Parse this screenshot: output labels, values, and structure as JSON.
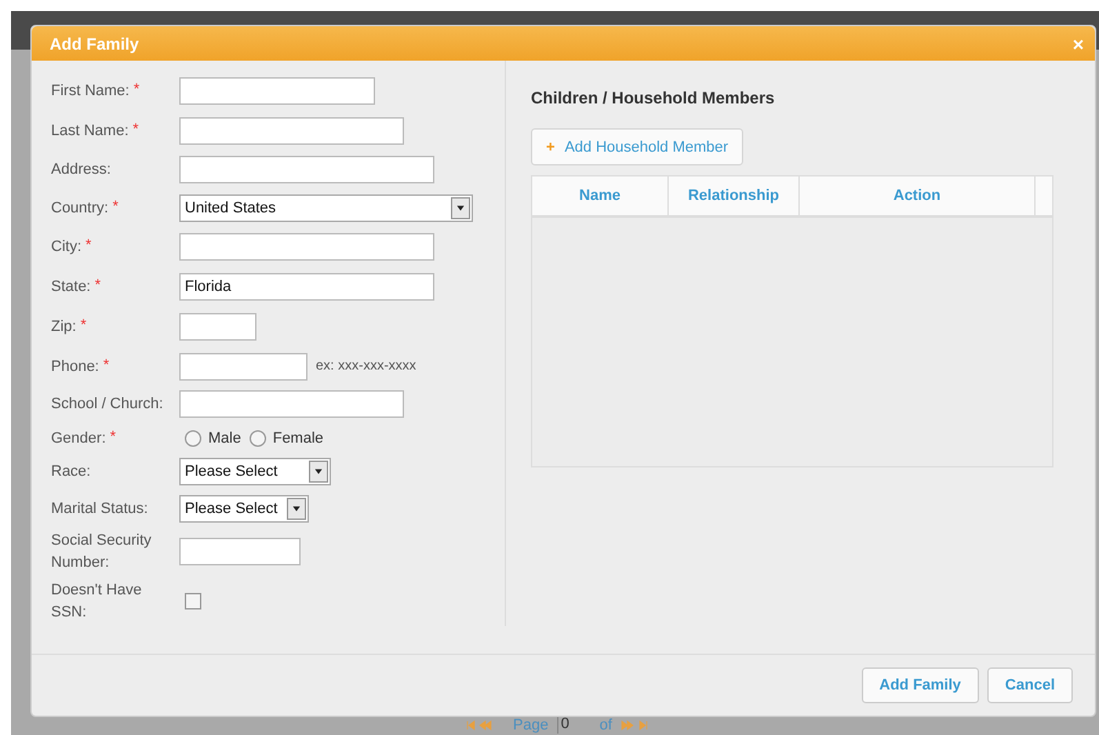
{
  "dialog": {
    "title": "Add Family",
    "close": "×"
  },
  "form": {
    "required_mark": "*",
    "fields": [
      {
        "kind": "text",
        "label": "First Name:",
        "required": true
      },
      {
        "kind": "text",
        "label": "Last Name:",
        "required": true
      },
      {
        "kind": "text",
        "label": "Address:",
        "required": false
      },
      {
        "kind": "select",
        "label": "Country:",
        "required": true,
        "value": "United States"
      },
      {
        "kind": "text",
        "label": "City:",
        "required": true
      },
      {
        "kind": "text",
        "label": "State:",
        "required": true,
        "value": "Florida"
      },
      {
        "kind": "text",
        "label": "Zip:",
        "required": true
      },
      {
        "kind": "text",
        "label": "Phone:",
        "required": true,
        "hint": "ex: xxx-xxx-xxxx"
      },
      {
        "kind": "text",
        "label": "School / Church:",
        "required": false
      },
      {
        "kind": "radio",
        "label": "Gender:",
        "required": true,
        "options": [
          {
            "label": "Male",
            "selected": false
          },
          {
            "label": "Female",
            "selected": false
          }
        ]
      },
      {
        "kind": "select",
        "label": "Race:",
        "required": false,
        "value": "Please Select"
      },
      {
        "kind": "select",
        "label": "Marital Status:",
        "required": false,
        "value": "Please Select"
      },
      {
        "kind": "text",
        "label": "Social Security Number:",
        "required": false
      },
      {
        "kind": "checkbox",
        "label": "Doesn't Have SSN:",
        "required": false,
        "checked": false
      }
    ]
  },
  "household": {
    "heading": "Children / Household Members",
    "add_button": {
      "icon": "+",
      "label": "Add Household Member"
    },
    "table": {
      "columns": [
        "Name",
        "Relationship",
        "Action"
      ]
    }
  },
  "footer": {
    "buttons": [
      "Add Family",
      "Cancel"
    ]
  },
  "pager": {
    "label": "Page",
    "page": "0",
    "of": "of"
  }
}
